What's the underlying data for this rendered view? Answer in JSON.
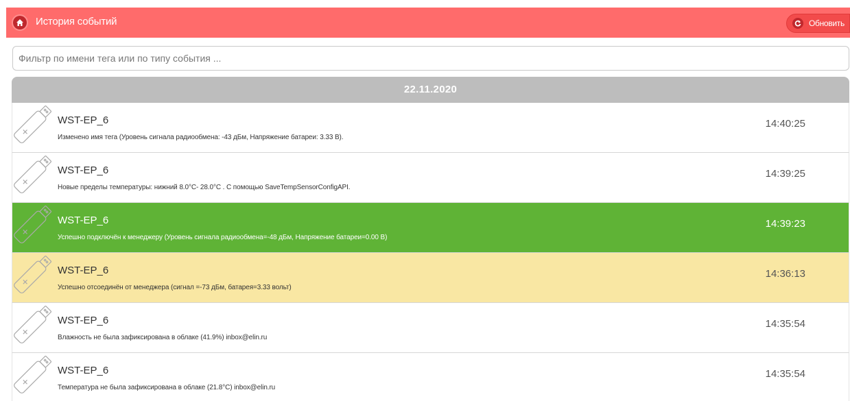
{
  "header": {
    "title": "История событий",
    "refresh_label": "Обновить"
  },
  "filter": {
    "placeholder": "Фильтр по имени тега или по типу события ...",
    "value": ""
  },
  "date": "22.11.2020",
  "events": [
    {
      "tag": "WST-EP_6",
      "desc": "Изменено имя тега (Уровень сигнала радиообмена: -43 дБм, Напряжение батареи: 3.33 В).",
      "time": "14:40:25",
      "status": "normal"
    },
    {
      "tag": "WST-EP_6",
      "desc": "Новые пределы температуры: нижний 8.0°C- 28.0°C . С помощью SaveTempSensorConfigAPI.",
      "time": "14:39:25",
      "status": "normal"
    },
    {
      "tag": "WST-EP_6",
      "desc": "Успешно подключён к менеджеру (Уровень сигнала радиообмена=-48 дБм, Напряжение батареи=0.00 В)",
      "time": "14:39:23",
      "status": "success"
    },
    {
      "tag": "WST-EP_6",
      "desc": "Успешно отсоединён от менеджера (сигнал =-73 дБм, батарея=3.33 вольт)",
      "time": "14:36:13",
      "status": "warning"
    },
    {
      "tag": "WST-EP_6",
      "desc": "Влажность не была зафиксирована в облаке (41.9%) inbox@elin.ru",
      "time": "14:35:54",
      "status": "normal"
    },
    {
      "tag": "WST-EP_6",
      "desc": "Температура не была зафиксирована в облаке (21.8°C) inbox@elin.ru",
      "time": "14:35:54",
      "status": "normal"
    }
  ],
  "colors": {
    "header": "#ff6b6b",
    "success": "#5fb336",
    "warning": "#f9e7a3",
    "date_header": "#bdbdbd"
  },
  "icons": {
    "home": "home-icon",
    "refresh": "refresh-icon",
    "tag": "usb-tag-icon"
  }
}
